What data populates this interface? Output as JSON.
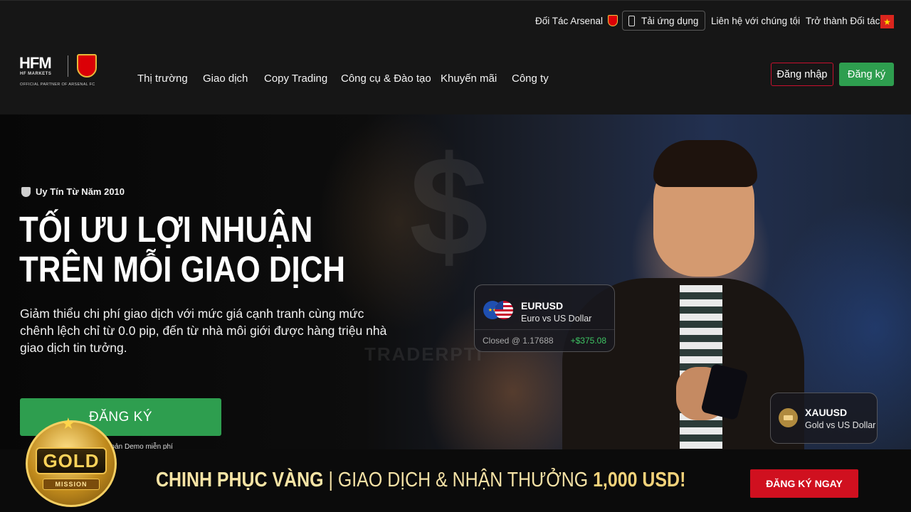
{
  "topbar": {
    "arsenal_partner": "Đối Tác Arsenal",
    "download_app": "Tải ứng dụng",
    "contact": "Liên hệ với chúng tôi",
    "become_partner": "Trở thành Đối tác",
    "language_flag": "vn-flag-icon"
  },
  "logo": {
    "brand_left": "HF",
    "brand_right": "M",
    "sub": "HF MARKETS",
    "partner_line": "OFFICIAL PARTNER OF ARSENAL FC"
  },
  "nav": {
    "items": [
      "Thị trường",
      "Giao dịch",
      "Copy Trading",
      "Công cụ & Đào tạo",
      "Khuyến mãi",
      "Công ty"
    ],
    "login": "Đăng nhập",
    "register": "Đăng ký"
  },
  "hero": {
    "badge": "Uy Tín Từ Năm 2010",
    "title_line1": "TỐI ƯU LỢI NHUẬN",
    "title_line2": "TRÊN MỖI GIAO DỊCH",
    "description": "Giảm thiểu chi phí giao dịch với mức giá cạnh tranh cùng mức chênh lệch chỉ từ 0.0 pip, đến từ nhà môi giới được hàng triệu nhà giao dịch tin tưởng.",
    "cta": "ĐĂNG KÝ",
    "demo_note": "hoản Demo miễn phí",
    "watermark_symbol": "$",
    "watermark_text": "TRADERPTI"
  },
  "cards": {
    "eurusd": {
      "symbol": "EURUSD",
      "name": "Euro vs US Dollar",
      "closed": "Closed @ 1.17688",
      "profit": "+$375.08"
    },
    "xauusd": {
      "symbol": "XAUUSD",
      "name": "Gold vs US Dollar"
    }
  },
  "promo": {
    "medal_word": "GOLD",
    "medal_ribbon": "MISSION",
    "text_bold": "CHINH PHỤC VÀNG",
    "text_sep": " | ",
    "text_normal": "GIAO DỊCH & NHẬN THƯỞNG ",
    "text_amount": "1,000 USD!",
    "button": "ĐĂNG KÝ NGAY"
  },
  "colors": {
    "brand_green": "#2e9e4f",
    "brand_red": "#c8102e",
    "promo_gold": "#f3d27a",
    "profit_green": "#3ec463"
  }
}
